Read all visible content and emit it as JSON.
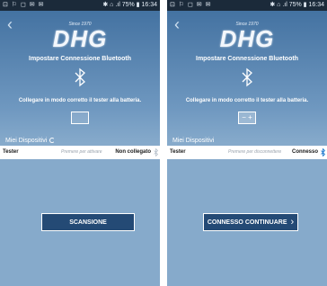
{
  "colors": {
    "status_bar": "#1b2a3a",
    "panel_top": "#3f6e9e",
    "panel_bottom": "#86aacb",
    "button_bg": "#244a75"
  },
  "screens": [
    {
      "status": {
        "left_icons": "⊡ ⚐ ◻ ✉ ✉",
        "right": "✱ ⌂ .ıl 75% ▮ 16:34"
      },
      "back_icon": "chevron-left-icon",
      "logo": {
        "tagline": "Since 1970",
        "text": "DHG"
      },
      "title": "Impostare Connessione Bluetooth",
      "instruction": "Collegare in modo corretto il tester alla batteria.",
      "my_devices_label": "Miei Dispositivi",
      "device": {
        "name": "Tester",
        "hint": "Premere per attivare",
        "status": "Non collegato"
      },
      "button_label": "SCANSIONE"
    },
    {
      "status": {
        "left_icons": "⊡ ⚐ ◻ ✉ ✉",
        "right": "✱ ⌂ .ıl 75% ▮ 16:34"
      },
      "back_icon": "chevron-left-icon",
      "logo": {
        "tagline": "Since 1970",
        "text": "DHG"
      },
      "title": "Impostare Connessione Bluetooth",
      "instruction": "Collegare in modo corretto il tester alla batteria.",
      "my_devices_label": "Miei Dispositivi",
      "device": {
        "name": "Tester",
        "hint": "Premere per disconnettere",
        "status": "Connesso"
      },
      "button_label": "CONNESSO CONTINUARE"
    }
  ]
}
